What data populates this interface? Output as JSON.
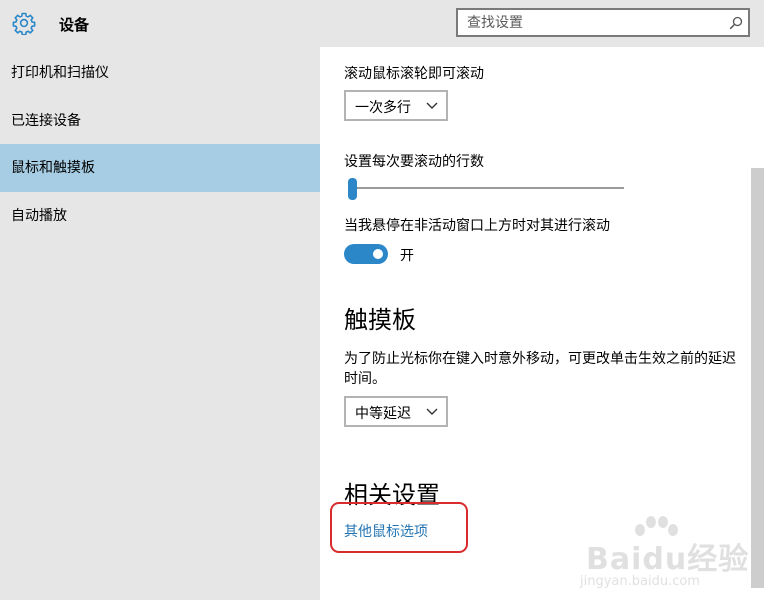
{
  "header": {
    "icon": "gear-icon",
    "title": "设备",
    "search": {
      "placeholder": "查找设置",
      "icon": "search-icon"
    }
  },
  "sidebar": {
    "items": [
      {
        "label": "打印机和扫描仪",
        "selected": false
      },
      {
        "label": "已连接设备",
        "selected": false
      },
      {
        "label": "鼠标和触摸板",
        "selected": true
      },
      {
        "label": "自动播放",
        "selected": false
      }
    ]
  },
  "main": {
    "scroll_section": {
      "label": "滚动鼠标滚轮即可滚动",
      "dropdown_value": "一次多行"
    },
    "lines_section": {
      "label": "设置每次要滚动的行数",
      "slider_level": 0.0
    },
    "inactive_scroll": {
      "label": "当我悬停在非活动窗口上方时对其进行滚动",
      "toggle_on": true,
      "toggle_text": "开"
    },
    "touchpad": {
      "heading": "触摸板",
      "description": "为了防止光标你在键入时意外移动，可更改单击生效之前的延迟时间。",
      "dropdown_value": "中等延迟"
    },
    "related": {
      "heading": "相关设置",
      "link": "其他鼠标选项"
    }
  },
  "watermark": {
    "brand": "Baidu经验",
    "url": "jingyan.baidu.com"
  },
  "colors": {
    "accent": "#2b87c8",
    "selected_bg": "#a6cde3",
    "chrome_bg": "#e6e6e6",
    "link": "#2475b4",
    "annotation": "#d92b2b"
  }
}
